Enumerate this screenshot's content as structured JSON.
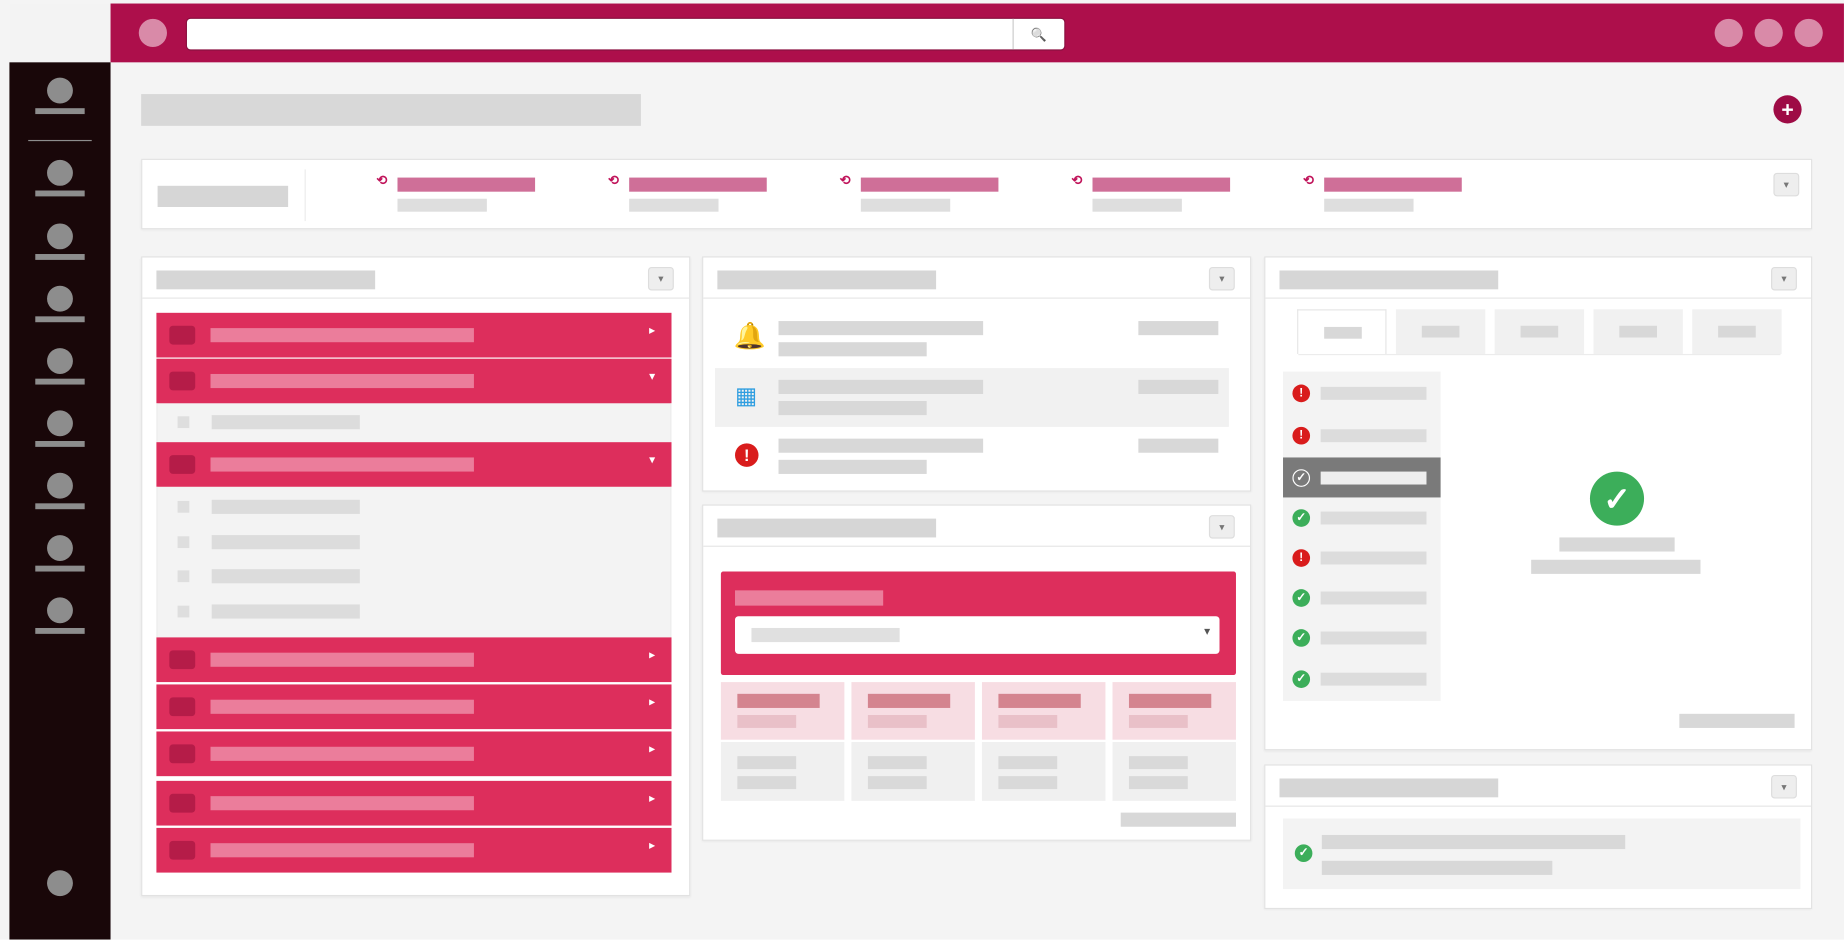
{
  "icons": {
    "search": "search-icon",
    "add": "plus-circle-icon",
    "bell": "bell-icon",
    "calendar": "calendar-icon",
    "alert": "alert-icon",
    "success": "check-circle-icon"
  },
  "colors": {
    "brand": "#ad0f4b",
    "accent": "#dd2e5c",
    "sidebar": "#190709",
    "bell": "#f5a623",
    "calendar": "#2f9ee0",
    "error": "#d91c1c",
    "success": "#3cae5a"
  },
  "glyphs": {
    "search": "🔍",
    "add": "+",
    "history": "⟲",
    "caret_down": "▾",
    "caret_right": "▸",
    "bell": "🔔",
    "calendar": "▦",
    "alert": "!",
    "check": "✓"
  },
  "summary_count": 5,
  "tabs_count": 5,
  "status_list": [
    "error",
    "error",
    "success",
    "success",
    "error",
    "success",
    "success",
    "success"
  ],
  "selected_status_index": 2
}
